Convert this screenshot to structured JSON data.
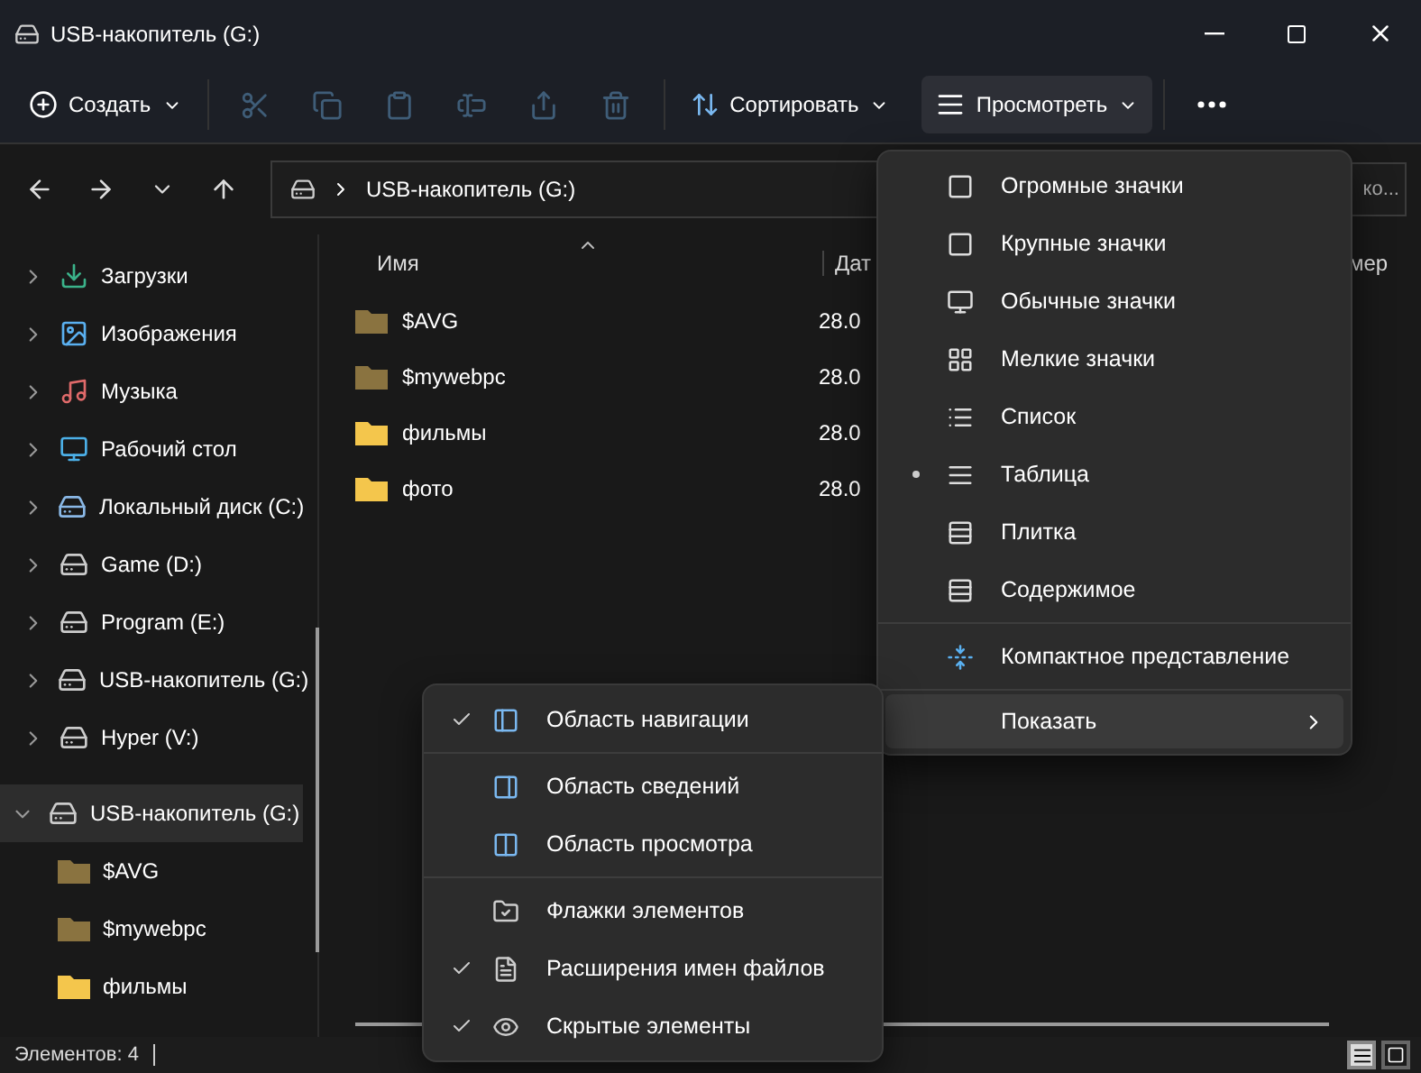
{
  "window": {
    "title": "USB-накопитель (G:)"
  },
  "toolbar": {
    "new_button": {
      "label": "Создать"
    },
    "actions": [
      {
        "kind": "cut",
        "disabled": true
      },
      {
        "kind": "copy",
        "disabled": true
      },
      {
        "kind": "paste",
        "disabled": true
      },
      {
        "kind": "rename",
        "disabled": true
      },
      {
        "kind": "share",
        "disabled": true
      },
      {
        "kind": "delete",
        "disabled": true
      }
    ],
    "sort_button": {
      "label": "Сортировать"
    },
    "view_button": {
      "label": "Просмотреть",
      "expanded": true
    }
  },
  "address_bar": {
    "path": "USB-накопитель (G:)"
  },
  "search": {
    "placeholder": "ко..."
  },
  "sidebar": {
    "items": [
      {
        "label": "Загрузки",
        "kind": "downloads",
        "expanded": false,
        "selected": false
      },
      {
        "label": "Изображения",
        "kind": "pictures",
        "expanded": false,
        "selected": false
      },
      {
        "label": "Музыка",
        "kind": "music",
        "expanded": false,
        "selected": false
      },
      {
        "label": "Рабочий стол",
        "kind": "desktop",
        "expanded": false,
        "selected": false
      },
      {
        "label": "Локальный диск (C:)",
        "kind": "system-drive",
        "expanded": false,
        "selected": false
      },
      {
        "label": "Game (D:)",
        "kind": "drive",
        "expanded": false,
        "selected": false
      },
      {
        "label": "Program (E:)",
        "kind": "drive",
        "expanded": false,
        "selected": false
      },
      {
        "label": "USB-накопитель (G:)",
        "kind": "drive",
        "expanded": false,
        "selected": false
      },
      {
        "label": "Hyper (V:)",
        "kind": "drive",
        "expanded": false,
        "selected": false
      },
      {
        "label": "USB-накопитель (G:)",
        "kind": "drive",
        "expanded": true,
        "selected": true,
        "children": [
          {
            "label": "$AVG",
            "kind": "hidden-folder"
          },
          {
            "label": "$mywebpc",
            "kind": "hidden-folder"
          },
          {
            "label": "фильмы",
            "kind": "folder"
          }
        ]
      }
    ]
  },
  "table": {
    "columns": [
      "Имя",
      "Дат",
      "мер"
    ],
    "rows": [
      {
        "name": "$AVG",
        "kind": "hidden-folder",
        "date": "28.0"
      },
      {
        "name": "$mywebpc",
        "kind": "hidden-folder",
        "date": "28.0"
      },
      {
        "name": "фильмы",
        "kind": "folder",
        "date": "28.0"
      },
      {
        "name": "фото",
        "kind": "folder",
        "date": "28.0"
      }
    ]
  },
  "view_menu": {
    "items": [
      {
        "label": "Огромные значки",
        "kind": "view",
        "selected": false
      },
      {
        "label": "Крупные значки",
        "kind": "view",
        "selected": false
      },
      {
        "label": "Обычные значки",
        "kind": "view",
        "selected": false
      },
      {
        "label": "Мелкие значки",
        "kind": "view",
        "selected": false
      },
      {
        "label": "Список",
        "kind": "view",
        "selected": false
      },
      {
        "label": "Таблица",
        "kind": "view",
        "selected": true
      },
      {
        "label": "Плитка",
        "kind": "view",
        "selected": false
      },
      {
        "label": "Содержимое",
        "kind": "view",
        "selected": false
      },
      {
        "label": "Компактное представление",
        "kind": "toggle",
        "checked": false
      },
      {
        "label": "Показать",
        "kind": "submenu",
        "expanded": true
      }
    ]
  },
  "show_menu": {
    "items": [
      {
        "label": "Область навигации",
        "checked": true
      },
      {
        "label": "Область сведений",
        "checked": false
      },
      {
        "label": "Область просмотра",
        "checked": false
      },
      {
        "label": "Флажки элементов",
        "checked": false
      },
      {
        "label": "Расширения имен файлов",
        "checked": true
      },
      {
        "label": "Скрытые элементы",
        "checked": true
      }
    ]
  },
  "status_bar": {
    "text": "Элементов: 4",
    "view_modes": [
      {
        "kind": "details",
        "selected": true
      },
      {
        "kind": "tiles",
        "selected": false
      }
    ]
  }
}
